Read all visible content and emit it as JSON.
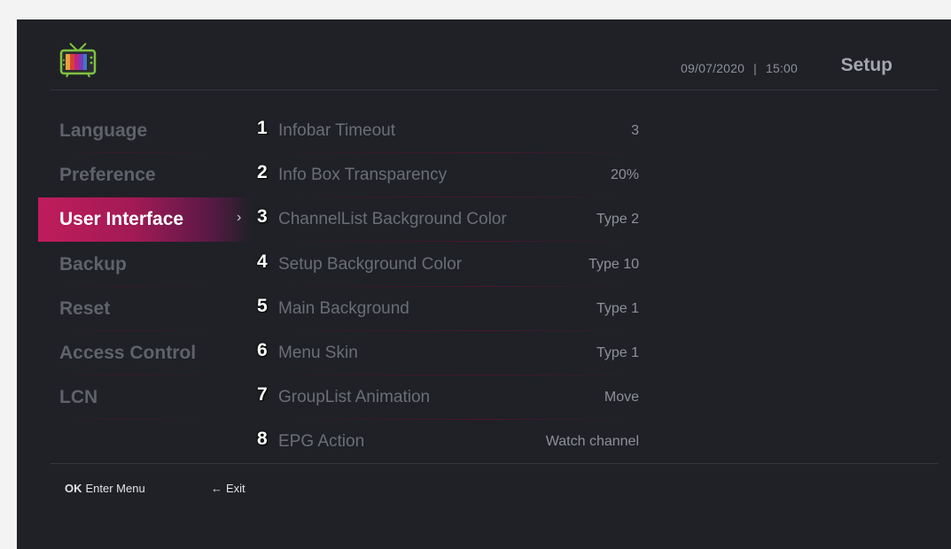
{
  "header": {
    "date": "09/07/2020",
    "separator": "|",
    "time": "15:00",
    "title": "Setup"
  },
  "sidebar": {
    "items": [
      {
        "label": "Language"
      },
      {
        "label": "Preference"
      },
      {
        "label": "User Interface",
        "active": true
      },
      {
        "label": "Backup"
      },
      {
        "label": "Reset"
      },
      {
        "label": "Access Control"
      },
      {
        "label": "LCN"
      }
    ],
    "selected_indicator": "›"
  },
  "settings": [
    {
      "num": "1",
      "label": "Infobar Timeout",
      "value": "3"
    },
    {
      "num": "2",
      "label": "Info Box Transparency",
      "value": "20%"
    },
    {
      "num": "3",
      "label": "ChannelList Background Color",
      "value": "Type 2"
    },
    {
      "num": "4",
      "label": "Setup Background Color",
      "value": "Type 10"
    },
    {
      "num": "5",
      "label": "Main Background",
      "value": "Type 1"
    },
    {
      "num": "6",
      "label": "Menu Skin",
      "value": "Type 1"
    },
    {
      "num": "7",
      "label": "GroupList Animation",
      "value": "Move"
    },
    {
      "num": "8",
      "label": "EPG Action",
      "value": "Watch channel"
    }
  ],
  "footer": {
    "ok_key": "OK",
    "ok_label": "Enter Menu",
    "exit_arrow": "←",
    "exit_label": "Exit"
  },
  "colors": {
    "screen_bg": "#1f2126",
    "accent": "#c01c5c",
    "active_text": "#ffffff",
    "inactive_text": "#5f626b"
  },
  "icons": {
    "logo": "retro-tv-icon",
    "exit": "left-arrow-icon"
  }
}
